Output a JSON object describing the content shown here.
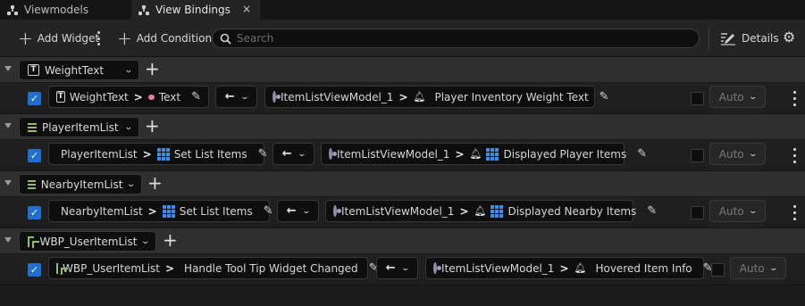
{
  "tabs": [
    {
      "label": "Viewmodels",
      "active": false
    },
    {
      "label": "View Bindings",
      "active": true,
      "close": "×"
    }
  ],
  "toolbar": {
    "add_widget": "Add Widget",
    "add_condition": "Add Condition",
    "search_placeholder": "Search",
    "details": "Details"
  },
  "groups": [
    {
      "widget": "WeightText",
      "icon": "text-icon",
      "binding": {
        "source_widget": "WeightText",
        "source_prop": "Text",
        "source_prop_icon": "pink-dot-icon",
        "mode": "←",
        "viewmodel": "ItemListViewModel_1",
        "target_prop": "Player Inventory Weight Text",
        "target_prop_icon": "pink-dot-icon",
        "enabled": true,
        "auto": "Auto"
      }
    },
    {
      "widget": "PlayerItemList",
      "icon": "list-icon",
      "binding": {
        "source_widget": "PlayerItemList",
        "source_prop": "Set List Items",
        "source_prop_icon": "grid-icon",
        "mode": "←",
        "viewmodel": "ItemListViewModel_1",
        "target_prop": "Displayed Player Items",
        "target_prop_icon": "grid-icon",
        "enabled": true,
        "auto": "Auto"
      }
    },
    {
      "widget": "NearbyItemList",
      "icon": "list-icon",
      "binding": {
        "source_widget": "NearbyItemList",
        "source_prop": "Set List Items",
        "source_prop_icon": "grid-icon",
        "mode": "←",
        "viewmodel": "ItemListViewModel_1",
        "target_prop": "Displayed Nearby Items",
        "target_prop_icon": "grid-icon",
        "enabled": true,
        "auto": "Auto"
      }
    },
    {
      "widget": "WBP_UserItemList",
      "icon": "user-widget-icon",
      "binding": {
        "source_widget": "WBP_UserItemList",
        "source_prop": "Handle Tool Tip Widget Changed",
        "source_prop_icon": "blue-dot-icon",
        "mode": "←",
        "viewmodel": "ItemListViewModel_1",
        "target_prop": "Hovered Item Info",
        "target_prop_icon": "blue-dot-icon",
        "enabled": true,
        "auto": "Auto"
      }
    }
  ],
  "colors": {
    "accent": "#1f6fd0",
    "pink_pin": "#e879a6",
    "blue_pin": "#2f7fe0",
    "list_green": "#8fbf6a"
  }
}
